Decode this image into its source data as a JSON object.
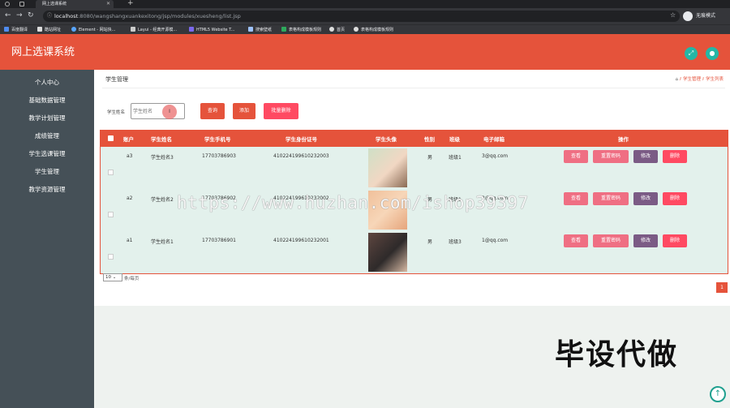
{
  "browser": {
    "tab_title": "网上选课系统",
    "url_host": "localhost",
    "url_rest": ":8080/wangshangxuankexitong/jsp/modules/xuesheng/list.jsp",
    "guest_label": "无痕模式",
    "bookmarks": [
      "百度翻译",
      "酷站网址",
      "Element - 网站快...",
      "Layui - 经典开源模...",
      "HTML5 Website T...",
      "搜索壁纸",
      "表格构成模板规则",
      "首页",
      "表格构成模板规则"
    ]
  },
  "header": {
    "title": "网上选课系统"
  },
  "sidebar": {
    "items": [
      {
        "label": "个人中心"
      },
      {
        "label": "基础数据管理"
      },
      {
        "label": "教学计划管理"
      },
      {
        "label": "成绩管理"
      },
      {
        "label": "学生选课管理"
      },
      {
        "label": "学生管理"
      },
      {
        "label": "教学资源管理"
      }
    ]
  },
  "main": {
    "page_title": "学生管理",
    "breadcrumb": [
      "学生管理",
      "学生列表"
    ],
    "search_label": "学生姓名",
    "search_placeholder": "学生姓名",
    "cursor_marker": "I",
    "buttons": {
      "query": "查询",
      "add": "添加",
      "batch_delete": "批量删除"
    },
    "colors": {
      "accent": "#e5533b",
      "view": "#ef6f83",
      "reset": "#ef6f83",
      "edit": "#7b5b85",
      "delete": "#ff4a62"
    }
  },
  "table": {
    "headers": [
      "账户",
      "学生姓名",
      "学生手机号",
      "学生身份证号",
      "学生头像",
      "性别",
      "班级",
      "电子邮箱",
      "操作"
    ],
    "rows": [
      {
        "account": "a3",
        "name": "学生姓名3",
        "phone": "17703786903",
        "id_card": "410224199610232003",
        "gender": "男",
        "class": "班级1",
        "email": "3@qq.com",
        "avatar": "portrait-icon"
      },
      {
        "account": "a2",
        "name": "学生姓名2",
        "phone": "17703786902",
        "id_card": "410224199610232002",
        "gender": "男",
        "class": "班级1",
        "email": "2@qq.com",
        "avatar": "portrait-icon"
      },
      {
        "account": "a1",
        "name": "学生姓名1",
        "phone": "17703786901",
        "id_card": "410224199610232001",
        "gender": "男",
        "class": "班级3",
        "email": "1@qq.com",
        "avatar": "portrait-icon"
      }
    ],
    "actions": {
      "view": "查看",
      "reset": "重置密码",
      "edit": "修改",
      "delete": "删除"
    }
  },
  "pagination": {
    "page_size": "10",
    "page_size_label": "条/每页",
    "current_page": "1"
  },
  "overlay": {
    "watermark": "https://www.huzhan.com/ishop39397",
    "caption": "毕设代做"
  }
}
